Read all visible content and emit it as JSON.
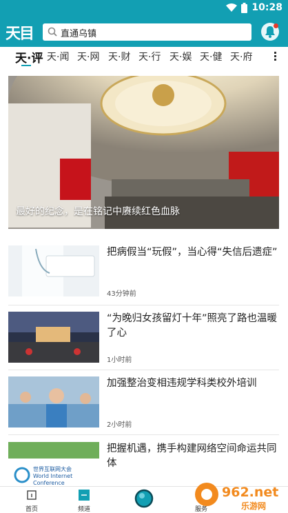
{
  "status_bar": {
    "time": "10:28"
  },
  "header": {
    "logo": "天目",
    "search_text": "直通乌镇"
  },
  "tabs": [
    "天·评",
    "天·闻",
    "天·网",
    "天·财",
    "天·行",
    "天·娱",
    "天·健",
    "天·府"
  ],
  "hero": {
    "caption": "最好的纪念，是在铭记中赓续红色血脉"
  },
  "news": [
    {
      "title": "把病假当“玩假”，当心得“失信后遗症”",
      "time": "43分钟前"
    },
    {
      "title": "“为晚归女孩留灯十年”照亮了路也温暖了心",
      "time": "1小时前"
    },
    {
      "title": "加强整治变相违规学科类校外培训",
      "time": "2小时前"
    },
    {
      "title": "把握机遇，携手构建网络空间命运共同体",
      "time": ""
    }
  ],
  "thumb4_text": {
    "line1": "世界互联网大会",
    "line2": "World Internet",
    "line3": "Conference"
  },
  "bottom_nav": {
    "home": "首页",
    "channel": "频道",
    "service": "服务"
  },
  "watermark": {
    "brand": "962.net",
    "sub": "乐游网"
  },
  "colors": {
    "accent": "#129fb3",
    "notification": "#e8392b"
  }
}
